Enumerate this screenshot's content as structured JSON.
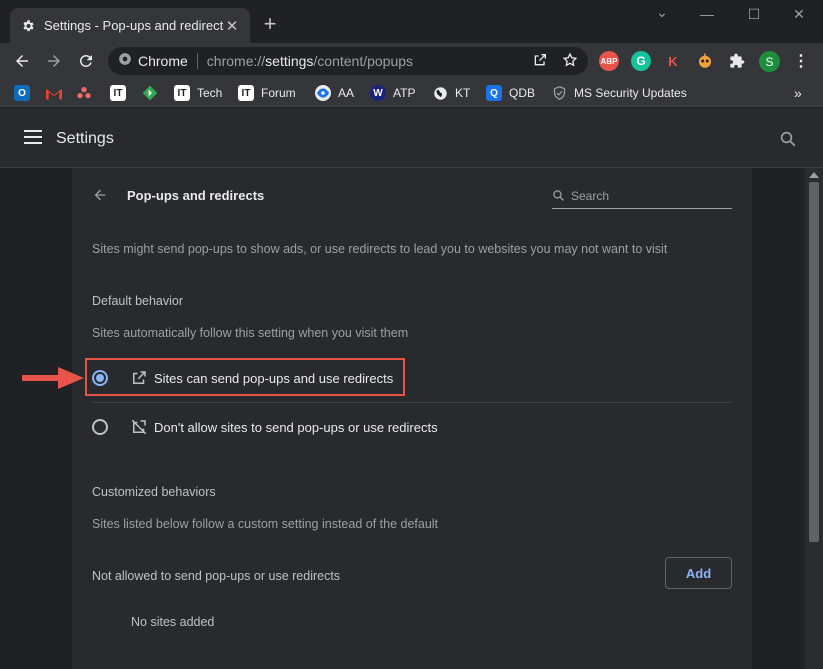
{
  "window": {
    "tab_title": "Settings - Pop-ups and redirects",
    "new_tab": "+",
    "close_tab": "✕",
    "minimize": "—",
    "maximize": "☐",
    "close": "✕",
    "collapse": "⌄"
  },
  "omnibox": {
    "site_label": "Chrome",
    "url_prefix": "chrome://",
    "url_host": "settings",
    "url_path": "/content/popups"
  },
  "extensions": [
    {
      "name": "adblock-plus",
      "text": "ABP",
      "color": "#e8534a"
    },
    {
      "name": "grammarly",
      "text": "G",
      "color": "#15c39a"
    },
    {
      "name": "k-extension",
      "text": "K",
      "color": "#35363a"
    },
    {
      "name": "puzzle",
      "text": ""
    },
    {
      "name": "profile",
      "text": "S",
      "color": "#1e8e3e"
    }
  ],
  "bookmarks": [
    {
      "label": "",
      "icon": "outlook-icon"
    },
    {
      "label": "",
      "icon": "gmail-icon"
    },
    {
      "label": "",
      "icon": "asana-icon"
    },
    {
      "label": "",
      "icon": "it-icon"
    },
    {
      "label": "",
      "icon": "diamond-icon"
    },
    {
      "label": "Tech",
      "icon": "it-icon"
    },
    {
      "label": "Forum",
      "icon": "it-icon"
    },
    {
      "label": "AA",
      "icon": "eye-icon"
    },
    {
      "label": "ATP",
      "icon": "atp-icon"
    },
    {
      "label": "KT",
      "icon": "globe-icon"
    },
    {
      "label": "QDB",
      "icon": "q-icon"
    },
    {
      "label": "MS Security Updates",
      "icon": "shield-icon"
    }
  ],
  "bookmarks_more": "»",
  "header": {
    "title": "Settings"
  },
  "page": {
    "title": "Pop-ups and redirects",
    "search_placeholder": "Search",
    "description": "Sites might send pop-ups to show ads, or use redirects to lead you to websites you may not want to visit",
    "default_behavior": {
      "title": "Default behavior",
      "description": "Sites automatically follow this setting when you visit them",
      "options": [
        {
          "label": "Sites can send pop-ups and use redirects",
          "checked": true
        },
        {
          "label": "Don't allow sites to send pop-ups or use redirects",
          "checked": false
        }
      ]
    },
    "customized": {
      "title": "Customized behaviors",
      "description": "Sites listed below follow a custom setting instead of the default",
      "not_allowed_label": "Not allowed to send pop-ups or use redirects",
      "add_label": "Add",
      "empty_label": "No sites added"
    }
  },
  "colors": {
    "accent": "#8ab4f8",
    "highlight": "#e8534a",
    "background": "#202124",
    "card": "#292a2d"
  }
}
